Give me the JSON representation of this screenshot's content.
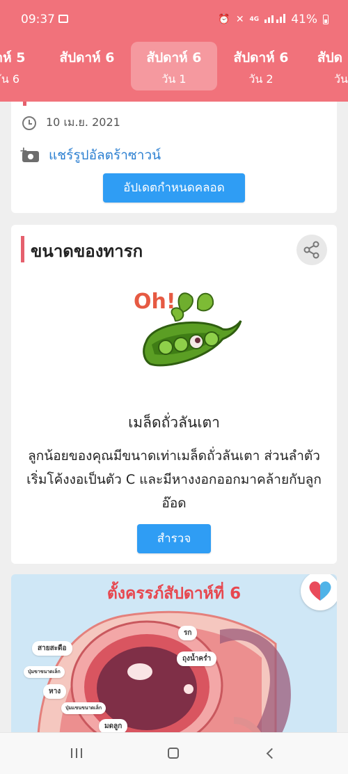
{
  "status_bar": {
    "time": "09:37",
    "network": "4G",
    "battery": "41%"
  },
  "week_tabs": [
    {
      "line1": "าห์ 5",
      "line2": "ัน 6"
    },
    {
      "line1": "สัปดาห์ 6",
      "line2": ""
    },
    {
      "line1": "สัปดาห์ 6",
      "line2": "วัน 1"
    },
    {
      "line1": "สัปดาห์ 6",
      "line2": "วัน 2"
    },
    {
      "line1": "สัปด",
      "line2": "วัน"
    }
  ],
  "due_card": {
    "date": "10 เม.ย. 2021",
    "share_ultrasound": "แชร์รูปอัลตร้าซาวน์",
    "update_button": "อัปเดตกำหนดคลอด"
  },
  "baby_size_card": {
    "title": "ขนาดของทารก",
    "image_text": "Oh!",
    "item_name": "เมล็ดถั่วลันเตา",
    "description": "ลูกน้อยของคุณมีขนาดเท่าเมล็ดถั่วลันเตา ส่วนลำตัวเริ่มโค้งงอเป็นตัว C และมีหางงอกออกมาคล้ายกับลูกอ๊อด",
    "explore_button": "สำรวจ"
  },
  "pregnancy_card": {
    "title": "ตั้งครรภ์สัปดาห์ที่ 6",
    "labels": {
      "placenta": "รก",
      "amniotic_sac": "ถุงน้ำคร่ำ",
      "umbilical_cord": "สายสะดือ",
      "small_leg_bud": "ปุ่มขาขนาดเล็ก",
      "tail": "หาง",
      "small_arm_bud": "ปุ่มแขนขนาดเล็ก",
      "uterus": "มดลูก"
    }
  },
  "colors": {
    "header": "#f1727b",
    "accent_red": "#e5606d",
    "button_blue": "#2f9df4",
    "link_blue": "#2b7fd1"
  }
}
